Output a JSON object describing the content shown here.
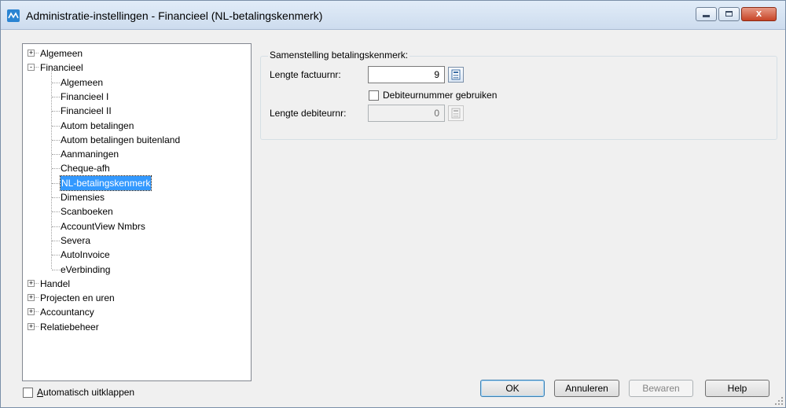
{
  "window": {
    "title": "Administratie-instellingen - Financieel (NL-betalingskenmerk)",
    "close_glyph": "x"
  },
  "tree": {
    "items": [
      {
        "label": "Algemeen",
        "level": 0,
        "expander": "+"
      },
      {
        "label": "Financieel",
        "level": 0,
        "expander": "-"
      },
      {
        "label": "Algemeen",
        "level": 1
      },
      {
        "label": "Financieel I",
        "level": 1
      },
      {
        "label": "Financieel II",
        "level": 1
      },
      {
        "label": "Autom betalingen",
        "level": 1
      },
      {
        "label": "Autom betalingen buitenland",
        "level": 1
      },
      {
        "label": "Aanmaningen",
        "level": 1
      },
      {
        "label": "Cheque-afh",
        "level": 1
      },
      {
        "label": "NL-betalingskenmerk",
        "level": 1,
        "selected": true
      },
      {
        "label": "Dimensies",
        "level": 1
      },
      {
        "label": "Scanboeken",
        "level": 1
      },
      {
        "label": "AccountView Nmbrs",
        "level": 1
      },
      {
        "label": "Severa",
        "level": 1
      },
      {
        "label": "AutoInvoice",
        "level": 1
      },
      {
        "label": "eVerbinding",
        "level": 1
      },
      {
        "label": "Handel",
        "level": 0,
        "expander": "+"
      },
      {
        "label": "Projecten en uren",
        "level": 0,
        "expander": "+"
      },
      {
        "label": "Accountancy",
        "level": 0,
        "expander": "+"
      },
      {
        "label": "Relatiebeheer",
        "level": 0,
        "expander": "+"
      }
    ]
  },
  "form": {
    "group_title": "Samenstelling betalingskenmerk:",
    "lengte_factuurnr_label": "Lengte factuurnr:",
    "lengte_factuurnr_value": "9",
    "debiteurnummer_checkbox_label": "Debiteurnummer gebruiken",
    "debiteurnummer_checked": false,
    "lengte_debiteurnr_label": "Lengte debiteurnr:",
    "lengte_debiteurnr_value": "0"
  },
  "footer": {
    "auto_expand_label": "Automatisch uitklappen",
    "ok_label": "OK",
    "cancel_label": "Annuleren",
    "save_label": "Bewaren",
    "help_label": "Help"
  },
  "icons": [
    "app-logo-icon",
    "minimize-icon",
    "maximize-icon",
    "close-icon",
    "calculator-icon",
    "resize-grip-icon"
  ],
  "colors": {
    "selection": "#3399ff",
    "app_icon": "#2a84d2",
    "close_button": "#c74426"
  }
}
